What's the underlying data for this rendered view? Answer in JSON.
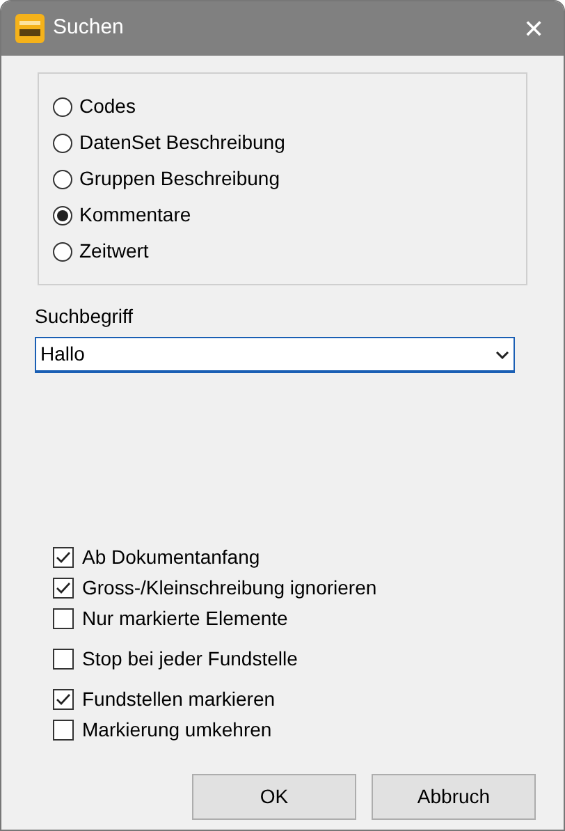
{
  "window": {
    "title": "Suchen",
    "close": "✕"
  },
  "search_in": [
    {
      "label": "Codes",
      "selected": false
    },
    {
      "label": "DatenSet Beschreibung",
      "selected": false
    },
    {
      "label": "Gruppen Beschreibung",
      "selected": false
    },
    {
      "label": "Kommentare",
      "selected": true
    },
    {
      "label": "Zeitwert",
      "selected": false
    }
  ],
  "search_term": {
    "label": "Suchbegriff",
    "value": "Hallo"
  },
  "option_groups": [
    {
      "options": [
        {
          "label": "Ab Dokumentanfang",
          "checked": true
        },
        {
          "label": "Gross-/Kleinschreibung ignorieren",
          "checked": true
        },
        {
          "label": "Nur markierte Elemente",
          "checked": false
        }
      ]
    },
    {
      "options": [
        {
          "label": "Stop bei jeder Fundstelle",
          "checked": false
        }
      ]
    },
    {
      "options": [
        {
          "label": "Fundstellen markieren",
          "checked": true
        },
        {
          "label": "Markierung umkehren",
          "checked": false
        }
      ]
    }
  ],
  "buttons": [
    "OK",
    "Abbruch"
  ]
}
